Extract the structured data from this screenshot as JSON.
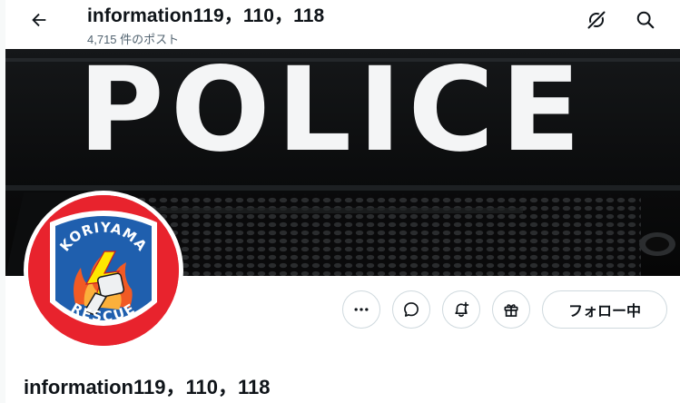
{
  "header": {
    "title": "information119，110，118",
    "post_count": "4,715 件のポスト"
  },
  "icons": {
    "back": "back-arrow-icon",
    "grok": "grok-icon",
    "search": "search-icon",
    "more": "more-icon",
    "message": "message-icon",
    "notify": "notification-add-icon",
    "gift": "gift-icon"
  },
  "banner": {
    "text": "POLICE"
  },
  "avatar": {
    "top_text": "KORIYAMA",
    "bottom_text": "RESCUE"
  },
  "actions": {
    "follow_label": "フォロー中"
  },
  "profile": {
    "display_name": "information119，110，118"
  },
  "colors": {
    "text_primary": "#0f1419",
    "text_secondary": "#536471",
    "border": "#cfd9de",
    "avatar_red": "#e8232d",
    "emblem_blue": "#1f5fae"
  }
}
